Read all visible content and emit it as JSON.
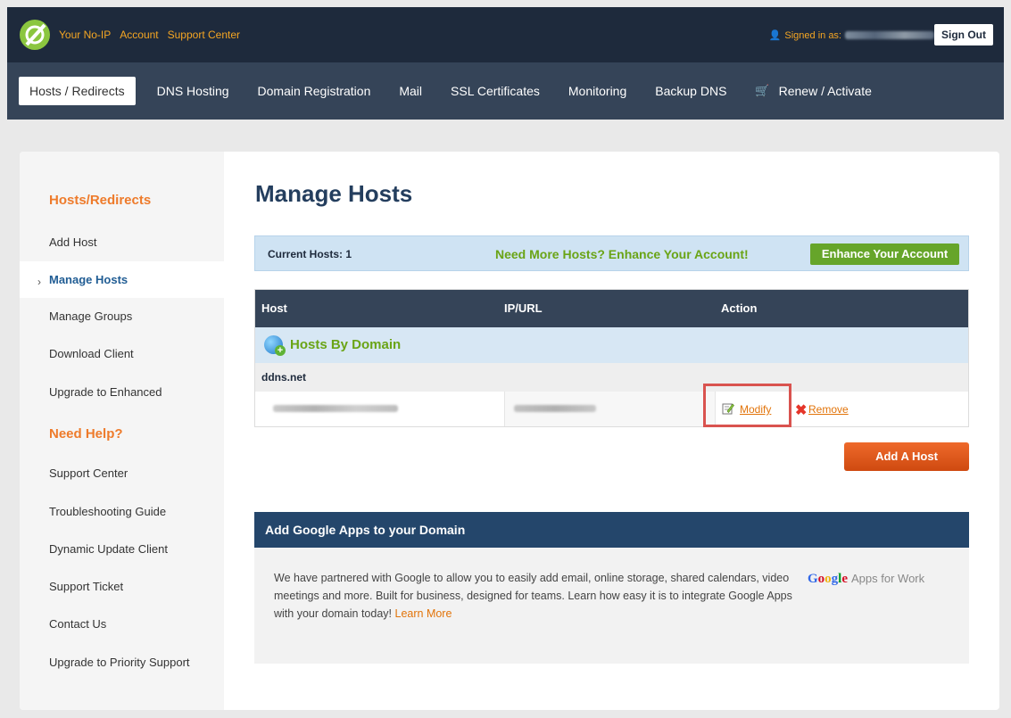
{
  "topbar": {
    "links": [
      "Your No-IP",
      "Account",
      "Support Center"
    ],
    "signed_in_label": "Signed in as:",
    "sign_out": "Sign Out"
  },
  "nav": {
    "items": [
      "Hosts / Redirects",
      "DNS Hosting",
      "Domain Registration",
      "Mail",
      "SSL Certificates",
      "Monitoring",
      "Backup DNS"
    ],
    "renew": "Renew / Activate"
  },
  "sidebar": {
    "section1": "Hosts/Redirects",
    "items1": [
      "Add Host",
      "Manage Hosts",
      "Manage Groups",
      "Download Client",
      "Upgrade to Enhanced"
    ],
    "section2": "Need Help?",
    "items2": [
      "Support Center",
      "Troubleshooting Guide",
      "Dynamic Update Client",
      "Support Ticket",
      "Contact Us",
      "Upgrade to Priority Support"
    ]
  },
  "main": {
    "title": "Manage Hosts",
    "current_hosts": "Current Hosts: 1",
    "need_more": "Need More Hosts? Enhance Your Account!",
    "enhance_button": "Enhance Your Account",
    "table": {
      "headers": [
        "Host",
        "IP/URL",
        "Action"
      ],
      "group_title": "Hosts By Domain",
      "domain": "ddns.net",
      "modify": "Modify",
      "remove": "Remove"
    },
    "add_host_button": "Add A Host"
  },
  "gapps": {
    "title": "Add Google Apps to your Domain",
    "body": "We have partnered with Google to allow you to easily add email, online storage, shared calendars, video meetings and more. Built for business, designed for teams. Learn how easy it is to integrate Google Apps with your domain today!",
    "learn_more": "Learn More",
    "logo_word": "Google",
    "logo_tag": "Apps for Work"
  },
  "colors": {
    "accent_orange": "#ee7b2b",
    "navy": "#1e2a3c",
    "green": "#66a52a"
  }
}
